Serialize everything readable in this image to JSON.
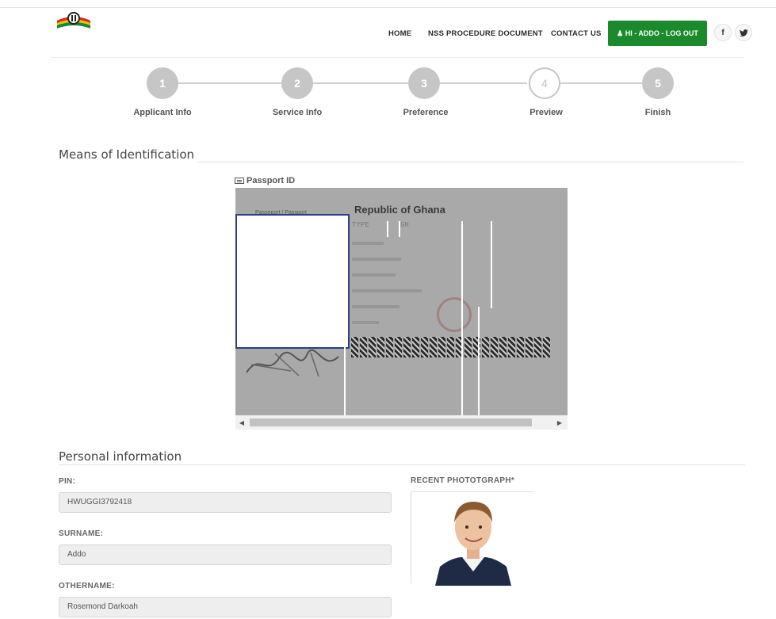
{
  "header": {
    "nav": [
      "HOME",
      "NSS PROCEDURE DOCUMENT",
      "CONTACT US"
    ],
    "logout_label": "♟ HI - ADDO - LOG OUT",
    "social": [
      "f",
      "♥"
    ],
    "colors": {
      "brand_green": "#1a8a2c"
    }
  },
  "stepper": {
    "steps": [
      {
        "number": "1",
        "label": "Applicant Info",
        "state": "complete"
      },
      {
        "number": "2",
        "label": "Service Info",
        "state": "complete"
      },
      {
        "number": "3",
        "label": "Preference",
        "state": "complete"
      },
      {
        "number": "4",
        "label": "Preview",
        "state": "current"
      },
      {
        "number": "5",
        "label": "Finish",
        "state": "pending"
      }
    ]
  },
  "identification": {
    "title": "Means of Identification",
    "passport_label": "Passport ID",
    "passport_image": {
      "title": "Republic of Ghana",
      "type_value": "TYPE",
      "code_value": "GH"
    }
  },
  "personal": {
    "title": "Personal information",
    "pin_label": "PIN:",
    "pin_value": "HWUGGI3792418",
    "surname_label": "SURNAME:",
    "surname_value": "Addo",
    "othername_label": "OTHERNAME:",
    "othername_value": "Rosemond Darkoah",
    "photo_label": "RECENT PHOTOTGRAPH*"
  }
}
